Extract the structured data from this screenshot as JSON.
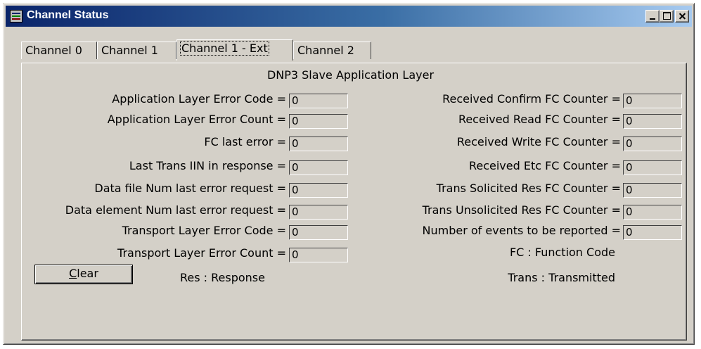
{
  "window": {
    "title": "Channel Status"
  },
  "tabs": [
    {
      "label": "Channel 0"
    },
    {
      "label": "Channel 1"
    },
    {
      "label": "Channel 1 - Ext"
    },
    {
      "label": "Channel 2"
    }
  ],
  "active_tab": "Channel 1 - Ext",
  "panel": {
    "title": "DNP3 Slave Application Layer"
  },
  "left_fields": [
    {
      "label": "Application Layer Error Code =",
      "value": "0"
    },
    {
      "label": "Application Layer Error Count =",
      "value": "0"
    },
    {
      "label": "FC last error =",
      "value": "0"
    },
    {
      "label": "Last Trans IIN in response =",
      "value": "0"
    },
    {
      "label": "Data file Num last error request =",
      "value": "0"
    },
    {
      "label": "Data element Num last error request =",
      "value": "0"
    },
    {
      "label": "Transport Layer Error Code =",
      "value": "0"
    },
    {
      "label": "Transport Layer Error Count =",
      "value": "0"
    }
  ],
  "right_fields": [
    {
      "label": "Received Confirm FC Counter =",
      "value": "0"
    },
    {
      "label": "Received Read FC Counter =",
      "value": "0"
    },
    {
      "label": "Received Write FC Counter =",
      "value": "0"
    },
    {
      "label": "Received Etc FC Counter =",
      "value": "0"
    },
    {
      "label": "Trans Solicited Res FC Counter =",
      "value": "0"
    },
    {
      "label": "Trans Unsolicited Res FC Counter =",
      "value": "0"
    },
    {
      "label": "Number of events to be reported =",
      "value": "0"
    }
  ],
  "notes": {
    "fc": "FC : Function Code",
    "res": "Res : Response",
    "trans": "Trans : Transmitted"
  },
  "buttons": {
    "clear_underlined": "C",
    "clear_rest": "lear"
  },
  "icons": {
    "app": "channel-status-app-icon",
    "minimize": "minimize-icon",
    "maximize": "maximize-icon",
    "close": "close-icon"
  },
  "colors": {
    "title_start": "#0a246a",
    "title_end": "#a6caf0",
    "face": "#d4d0c8"
  }
}
